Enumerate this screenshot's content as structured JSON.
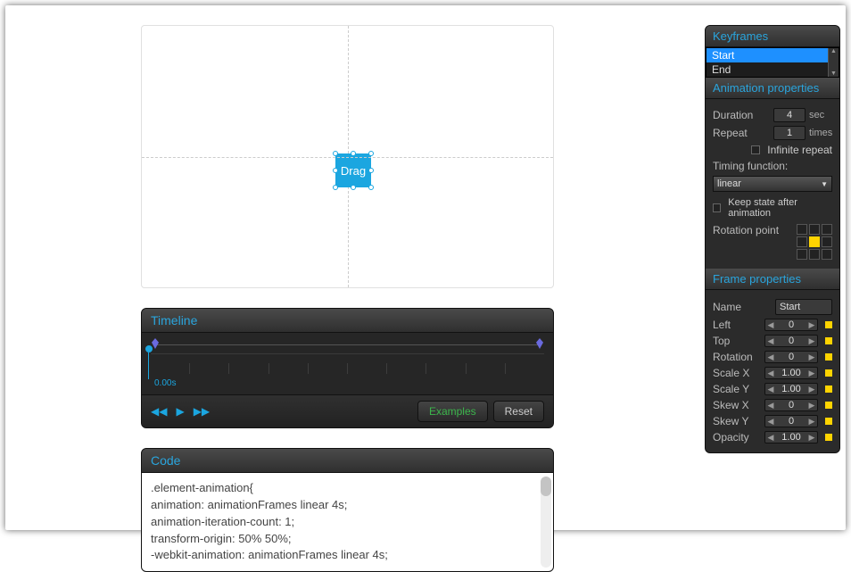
{
  "canvas": {
    "drag_label": "Drag"
  },
  "timeline": {
    "title": "Timeline",
    "time_label": "0.00s",
    "examples_btn": "Examples",
    "reset_btn": "Reset"
  },
  "code": {
    "title": "Code",
    "lines": [
      ".element-animation{",
      "  animation: animationFrames linear 4s;",
      "  animation-iteration-count: 1;",
      "  transform-origin: 50% 50%;",
      "  -webkit-animation: animationFrames linear 4s;"
    ]
  },
  "keyframes": {
    "title": "Keyframes",
    "items": [
      "Start",
      "End"
    ],
    "selected": "Start"
  },
  "anim_props": {
    "title": "Animation properties",
    "duration_label": "Duration",
    "duration_val": "4",
    "duration_unit": "sec",
    "repeat_label": "Repeat",
    "repeat_val": "1",
    "repeat_unit": "times",
    "infinite_label": "Infinite repeat",
    "timing_label": "Timing function:",
    "timing_val": "linear",
    "keep_state_label": "Keep state after animation",
    "rotation_point_label": "Rotation point"
  },
  "frame_props": {
    "title": "Frame properties",
    "name_label": "Name",
    "name_val": "Start",
    "rows": [
      {
        "label": "Left",
        "val": "0"
      },
      {
        "label": "Top",
        "val": "0"
      },
      {
        "label": "Rotation",
        "val": "0"
      },
      {
        "label": "Scale X",
        "val": "1.00"
      },
      {
        "label": "Scale Y",
        "val": "1.00"
      },
      {
        "label": "Skew X",
        "val": "0"
      },
      {
        "label": "Skew Y",
        "val": "0"
      },
      {
        "label": "Opacity",
        "val": "1.00"
      }
    ]
  }
}
